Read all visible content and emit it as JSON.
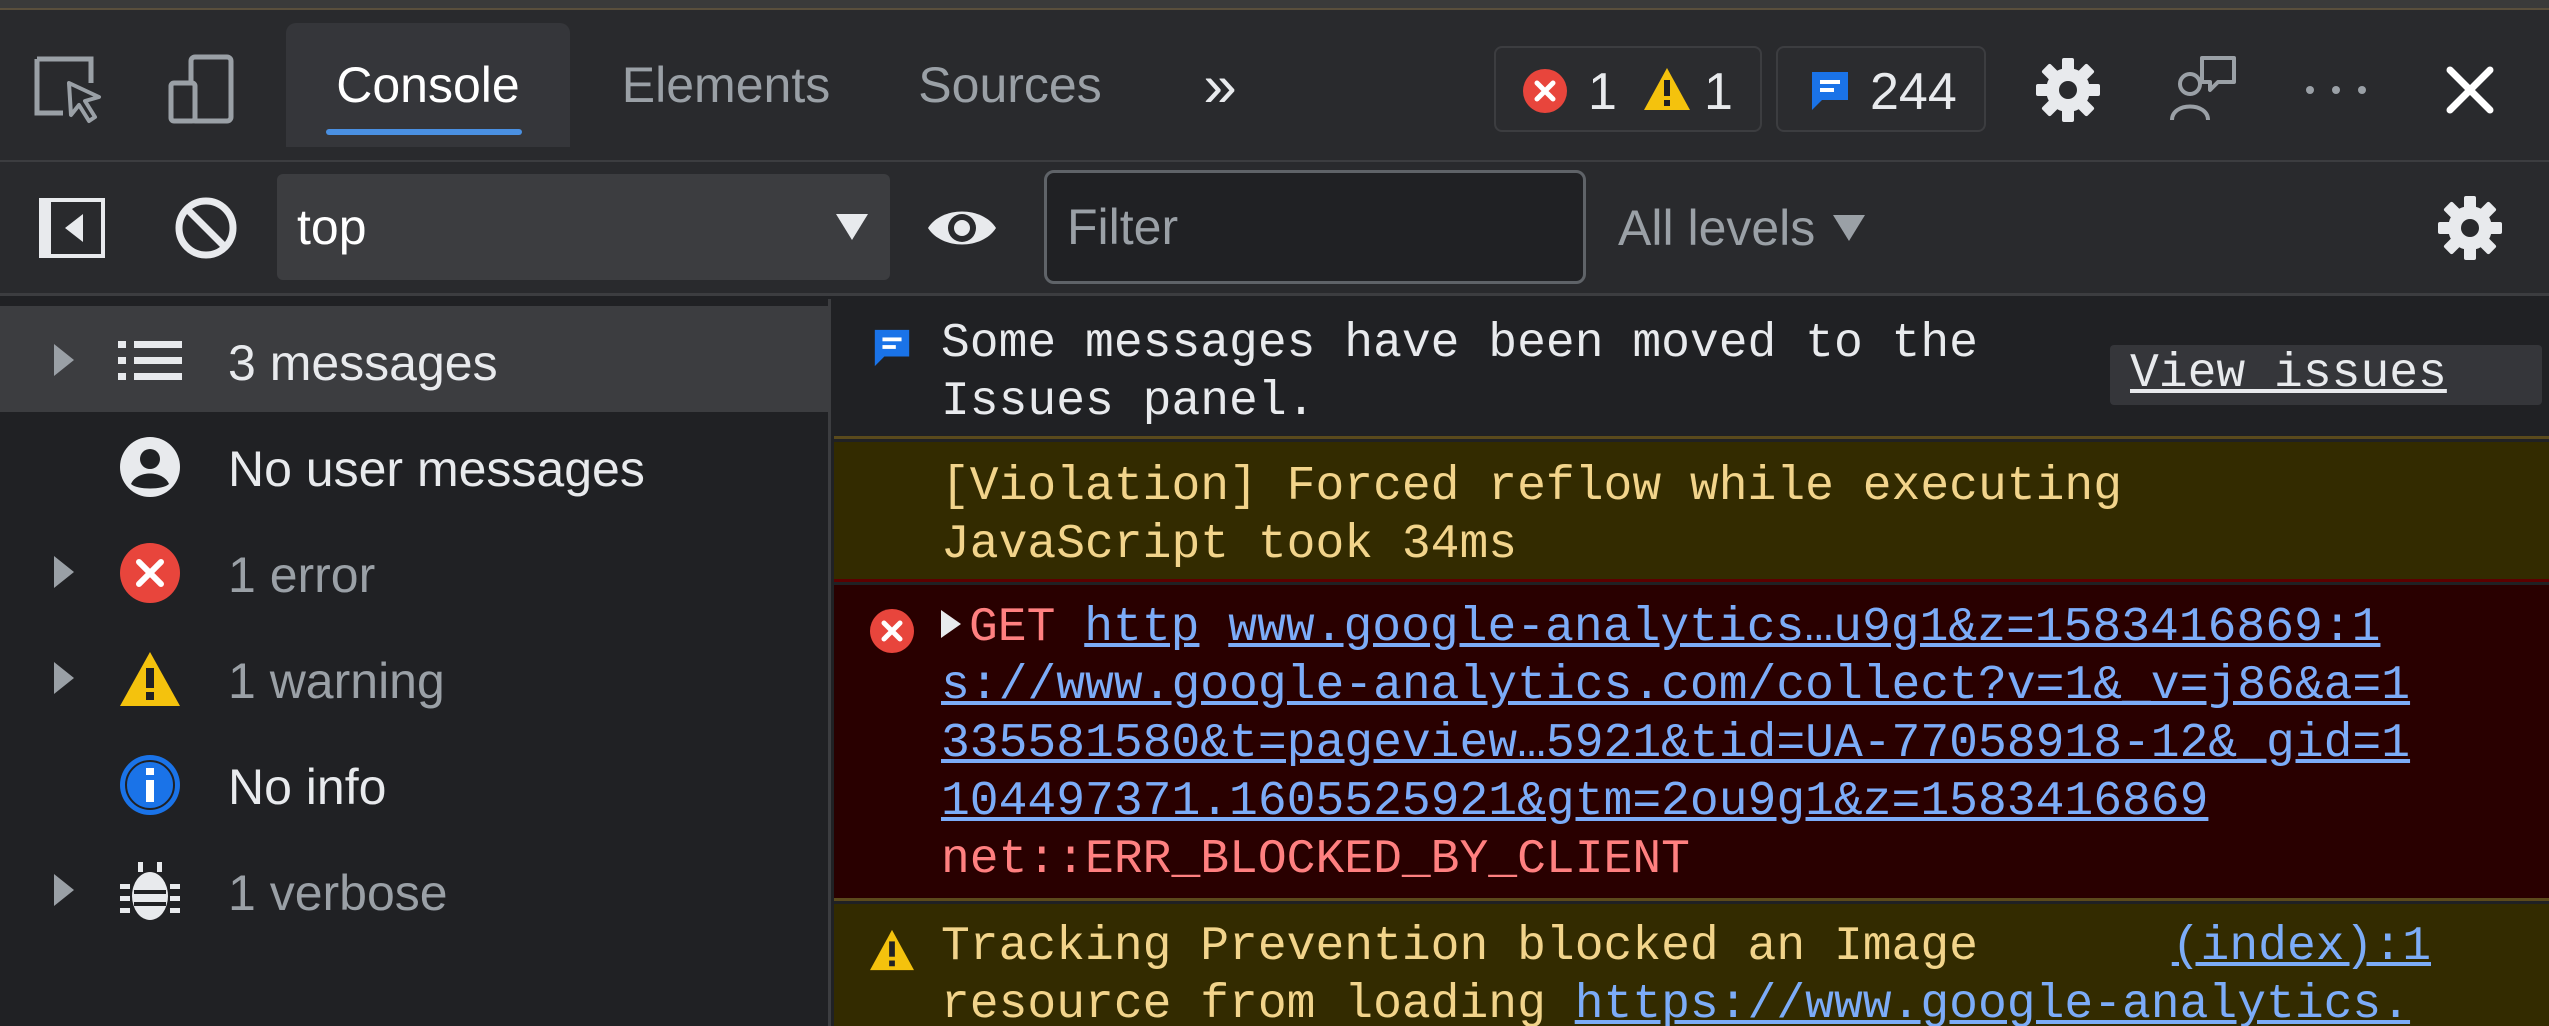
{
  "tabbar": {
    "tabs": [
      {
        "label": "Console",
        "active": true
      },
      {
        "label": "Elements",
        "active": false
      },
      {
        "label": "Sources",
        "active": false
      }
    ],
    "more_tabs_glyph": "»",
    "error_count": "1",
    "warning_count": "1",
    "issues_count": "244"
  },
  "toolbar2": {
    "context": "top",
    "filter_placeholder": "Filter",
    "levels_label": "All levels"
  },
  "sidebar": {
    "items": [
      {
        "label": "3 messages",
        "icon": "list-icon",
        "expandable": true,
        "selected": true
      },
      {
        "label": "No user messages",
        "icon": "user-icon",
        "expandable": false
      },
      {
        "label": "1 error",
        "icon": "error-icon",
        "expandable": true
      },
      {
        "label": "1 warning",
        "icon": "warning-icon",
        "expandable": true
      },
      {
        "label": "No info",
        "icon": "info-icon",
        "expandable": false
      },
      {
        "label": "1 verbose",
        "icon": "bug-icon",
        "expandable": true
      }
    ]
  },
  "console": {
    "info_line1": "Some messages have been moved to the",
    "info_line2": "Issues panel.",
    "view_issues": "View issues",
    "violation_line1": "[Violation] Forced reflow while executing",
    "violation_line2": "JavaScript took 34ms",
    "error_method": "GET",
    "error_url_a": "http",
    "error_source": "www.google-analytics…u9g1&z=1583416869:1",
    "error_url_line2": "s://www.google-analytics.com/collect?v=1&_v=j86&a=1",
    "error_url_line3": "335581580&t=pageview…5921&tid=UA-77058918-12&_gid=1",
    "error_url_line4": "104497371.1605525921&gtm=2ou9g1&z=1583416869",
    "error_reason": "net::ERR_BLOCKED_BY_CLIENT",
    "warning_line1": "Tracking Prevention blocked an Image",
    "warning_source": "(index):1",
    "warning_line2_prefix": "resource from loading ",
    "warning_line2_url": "https://www.google-analytics."
  },
  "colors": {
    "accent": "#4a90e2",
    "error": "#e8453c",
    "warning": "#f4c20d",
    "info": "#1a73e8",
    "link": "#7cacf8"
  }
}
